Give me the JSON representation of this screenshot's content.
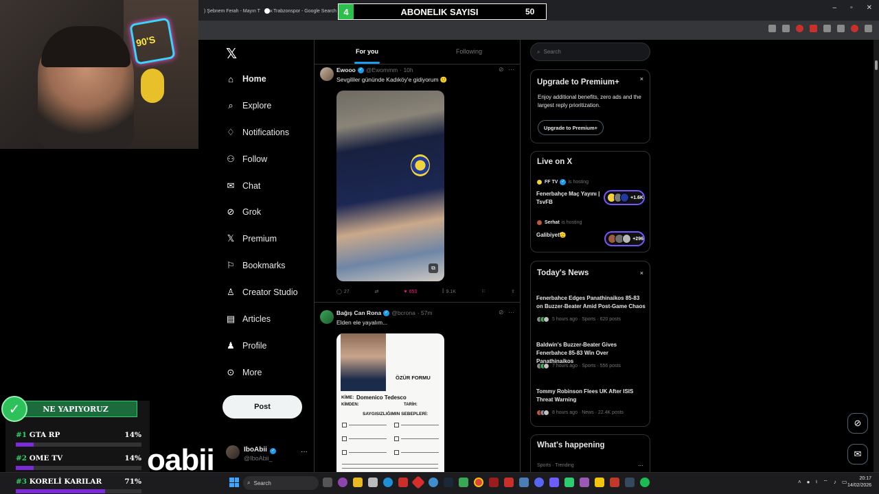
{
  "browser": {
    "tabs": [
      {
        "label": ") Şebnem Ferah - Mayın T",
        "close": "×"
      },
      {
        "label": "Trabzonspor - Google Search",
        "close": "×"
      }
    ],
    "window_controls": [
      "–",
      "▫",
      "✕"
    ]
  },
  "subscriber_counter": {
    "badge": "4",
    "label": "ABONELIK SAYISI",
    "count": "50"
  },
  "webcam": {
    "neon_sign": "90'S"
  },
  "nav": {
    "items": [
      {
        "label": "Home",
        "icon": "home-icon"
      },
      {
        "label": "Explore",
        "icon": "search-icon"
      },
      {
        "label": "Notifications",
        "icon": "bell-icon"
      },
      {
        "label": "Follow",
        "icon": "person-add-icon"
      },
      {
        "label": "Chat",
        "icon": "mail-icon"
      },
      {
        "label": "Grok",
        "icon": "grok-icon"
      },
      {
        "label": "Premium",
        "icon": "x-icon"
      },
      {
        "label": "Bookmarks",
        "icon": "bookmark-icon"
      },
      {
        "label": "Creator Studio",
        "icon": "creator-icon"
      },
      {
        "label": "Articles",
        "icon": "article-icon"
      },
      {
        "label": "Profile",
        "icon": "person-icon"
      },
      {
        "label": "More",
        "icon": "more-circle-icon"
      }
    ],
    "post_button": "Post",
    "account": {
      "name": "IboAbii",
      "handle": "@IboAbii_"
    }
  },
  "feed": {
    "tabs": {
      "for_you": "For you",
      "following": "Following"
    },
    "tweets": [
      {
        "name": "Ewooo",
        "handle": "@Ewommm",
        "time": "· 10h",
        "text": "Sevgililer gününde Kadıköy'e gidiyorum 🙂",
        "replies": "27",
        "likes": "653",
        "views": "9.1K"
      },
      {
        "name": "Bağış Can Rona",
        "handle": "@bcrona",
        "time": "· 57m",
        "text": "Elden ele yayalım...",
        "doc": {
          "title": "ÖZÜR FORMU",
          "kime_label": "KİME:",
          "kime_value": "Domenico Tedesco",
          "kimden_label": "KİMDEN:",
          "tarih_label": "TARİH:",
          "reasons_title": "SAYGISIZLIĞIMIN SEBEPLERİ:"
        }
      }
    ]
  },
  "right": {
    "search_placeholder": "Search",
    "premium": {
      "title": "Upgrade to Premium+",
      "body": "Enjoy additional benefits, zero ads and the largest reply prioritization.",
      "button": "Upgrade to Premium+",
      "close": "×"
    },
    "live": {
      "title": "Live on X",
      "items": [
        {
          "host": "FF TV",
          "suffix": "is hosting",
          "title": "Fenerbahçe Maç Yayını | TsvFB",
          "count": "+1.6K"
        },
        {
          "host": "Serhat",
          "suffix": "is hosting",
          "title": "Galibiyet🫡",
          "count": "+296"
        }
      ]
    },
    "news": {
      "title": "Today's News",
      "close": "×",
      "items": [
        {
          "headline": "Fenerbahce Edges Panathinaikos 85-83 on Buzzer-Beater Amid Post-Game Chaos",
          "meta": "5 hours ago · Sports · 620 posts"
        },
        {
          "headline": "Baldwin's Buzzer-Beater Gives Fenerbahce 85-83 Win Over Panathinaikos",
          "meta": "7 hours ago · Sports · 556 posts"
        },
        {
          "headline": "Tommy Robinson Flees UK After ISIS Threat Warning",
          "meta": "8 hours ago · News · 22.4K posts"
        }
      ]
    },
    "happening": {
      "title": "What's happening",
      "sub": "Sports · Trending"
    }
  },
  "poll": {
    "title": "NE YAPIYORUZ",
    "rows": [
      {
        "num": "#1",
        "label": "GTA RP",
        "pct": "14%",
        "value": 14
      },
      {
        "num": "#2",
        "label": "OME TV",
        "pct": "14%",
        "value": 14
      },
      {
        "num": "#3",
        "label": "KORELİ KARILAR",
        "pct": "71%",
        "value": 71
      }
    ]
  },
  "overlay_text": "oabii",
  "taskbar": {
    "search": "Search",
    "time": "20:17",
    "date": "14/02/2026"
  }
}
